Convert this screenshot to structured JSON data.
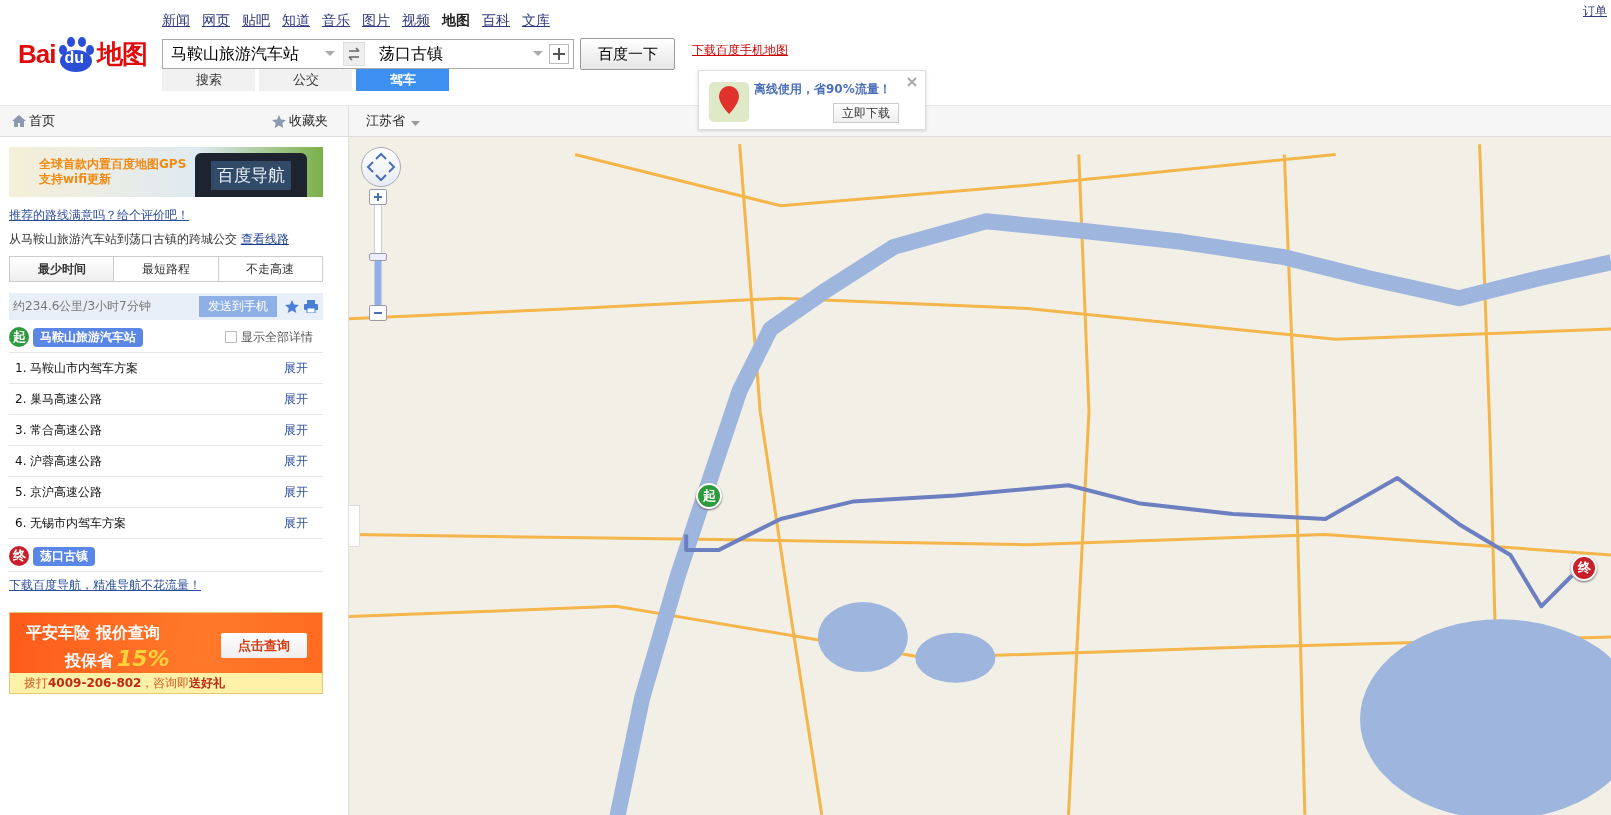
{
  "header": {
    "logo": {
      "text1": "Bai",
      "text2": "du",
      "text3": "地图"
    },
    "nav_links": [
      {
        "label": "新闻",
        "selected": false
      },
      {
        "label": "网页",
        "selected": false
      },
      {
        "label": "贴吧",
        "selected": false
      },
      {
        "label": "知道",
        "selected": false
      },
      {
        "label": "音乐",
        "selected": false
      },
      {
        "label": "图片",
        "selected": false
      },
      {
        "label": "视频",
        "selected": false
      },
      {
        "label": "地图",
        "selected": true
      },
      {
        "label": "百科",
        "selected": false
      },
      {
        "label": "文库",
        "selected": false
      }
    ],
    "origin_field": {
      "value": "马鞍山旅游汽车站"
    },
    "destination_field": {
      "value": "荡口古镇"
    },
    "search_button": "百度一下",
    "mode_tabs": [
      {
        "label": "搜索",
        "selected": false
      },
      {
        "label": "公交",
        "selected": false
      },
      {
        "label": "驾车",
        "selected": true
      }
    ],
    "app_link": "下载百度手机地图",
    "account_link": "订单"
  },
  "popup": {
    "text": "离线使用，省90%流量！",
    "button": "立即下载"
  },
  "toolbar": {
    "home": "首页",
    "favorites": "收藏夹",
    "province": "江苏省"
  },
  "sidebar": {
    "banner": {
      "lines": [
        "全球首款内置百度地图GPS",
        "支持wifi更新"
      ],
      "product": "百度导航"
    },
    "feedback_link": "推荐的路线满意吗？给个评价吧！",
    "transit_note": {
      "text": "从马鞍山旅游汽车站到荡口古镇的跨城公交",
      "link": "查看线路"
    },
    "route_tabs": [
      {
        "label": "最少时间",
        "selected": true
      },
      {
        "label": "最短路程",
        "selected": false
      },
      {
        "label": "不走高速",
        "selected": false
      }
    ],
    "summary": {
      "text": "约234.6公里/3小时7分钟",
      "send_button": "发送到手机"
    },
    "start": {
      "badge": "起",
      "name": "马鞍山旅游汽车站"
    },
    "show_details": {
      "label": "显示全部详情",
      "checked": false
    },
    "steps": [
      {
        "label": "1. 马鞍山市内驾车方案",
        "action": "展开"
      },
      {
        "label": "2. 巢马高速公路",
        "action": "展开"
      },
      {
        "label": "3. 常合高速公路",
        "action": "展开"
      },
      {
        "label": "4. 沪蓉高速公路",
        "action": "展开"
      },
      {
        "label": "5. 京沪高速公路",
        "action": "展开"
      },
      {
        "label": "6. 无锡市内驾车方案",
        "action": "展开"
      }
    ],
    "end": {
      "badge": "终",
      "name": "荡口古镇"
    },
    "nav_link": "下载百度导航，精准导航不花流量！",
    "ad": {
      "line1": "平安车险 报价查询",
      "line2": "投保省",
      "highlight": "15%",
      "button": "点击查询",
      "footer": "拨打**4009-206-802**，咨询即**送好礼**"
    }
  },
  "map": {
    "zoom_slider": {
      "level": 0.48
    },
    "start_marker": "起",
    "end_marker": "终"
  }
}
